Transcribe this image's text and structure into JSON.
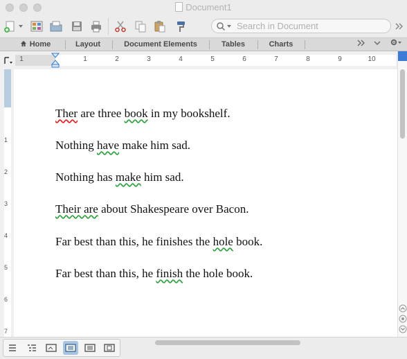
{
  "window": {
    "title": "Document1"
  },
  "toolbar": {
    "search_placeholder": "Search in Document"
  },
  "ribbon": {
    "tabs": [
      {
        "label": "Home"
      },
      {
        "label": "Layout"
      },
      {
        "label": "Document Elements"
      },
      {
        "label": "Tables"
      },
      {
        "label": "Charts"
      }
    ]
  },
  "ruler": {
    "numbers": [
      "1",
      "1",
      "2",
      "3",
      "4",
      "5",
      "6",
      "7",
      "8",
      "9",
      "10"
    ]
  },
  "vertical_ruler": {
    "numbers": [
      "1",
      "2",
      "3",
      "4",
      "5",
      "6",
      "7"
    ]
  },
  "document": {
    "lines": [
      {
        "segments": [
          {
            "text": "Ther",
            "mark": "red"
          },
          {
            "text": " are three ",
            "mark": ""
          },
          {
            "text": "book",
            "mark": "green"
          },
          {
            "text": " in my bookshelf.",
            "mark": ""
          }
        ]
      },
      {
        "segments": [
          {
            "text": "Nothing ",
            "mark": ""
          },
          {
            "text": "have",
            "mark": "green"
          },
          {
            "text": " make him sad.",
            "mark": ""
          }
        ]
      },
      {
        "segments": [
          {
            "text": "Nothing has ",
            "mark": ""
          },
          {
            "text": "make",
            "mark": "green"
          },
          {
            "text": " him sad.",
            "mark": ""
          }
        ]
      },
      {
        "segments": [
          {
            "text": "Their are",
            "mark": "green"
          },
          {
            "text": " about Shakespeare over Bacon.",
            "mark": ""
          }
        ]
      },
      {
        "segments": [
          {
            "text": "Far best than this, he finishes the ",
            "mark": ""
          },
          {
            "text": "hole",
            "mark": "green"
          },
          {
            "text": " book.",
            "mark": ""
          }
        ]
      },
      {
        "segments": [
          {
            "text": "Far best than this, he ",
            "mark": ""
          },
          {
            "text": "finish",
            "mark": "green"
          },
          {
            "text": " the hole book.",
            "mark": ""
          }
        ]
      }
    ]
  },
  "colors": {
    "spelling_error": "#e02020",
    "grammar_error": "#2fa040",
    "active_view": "#a9c4de"
  }
}
